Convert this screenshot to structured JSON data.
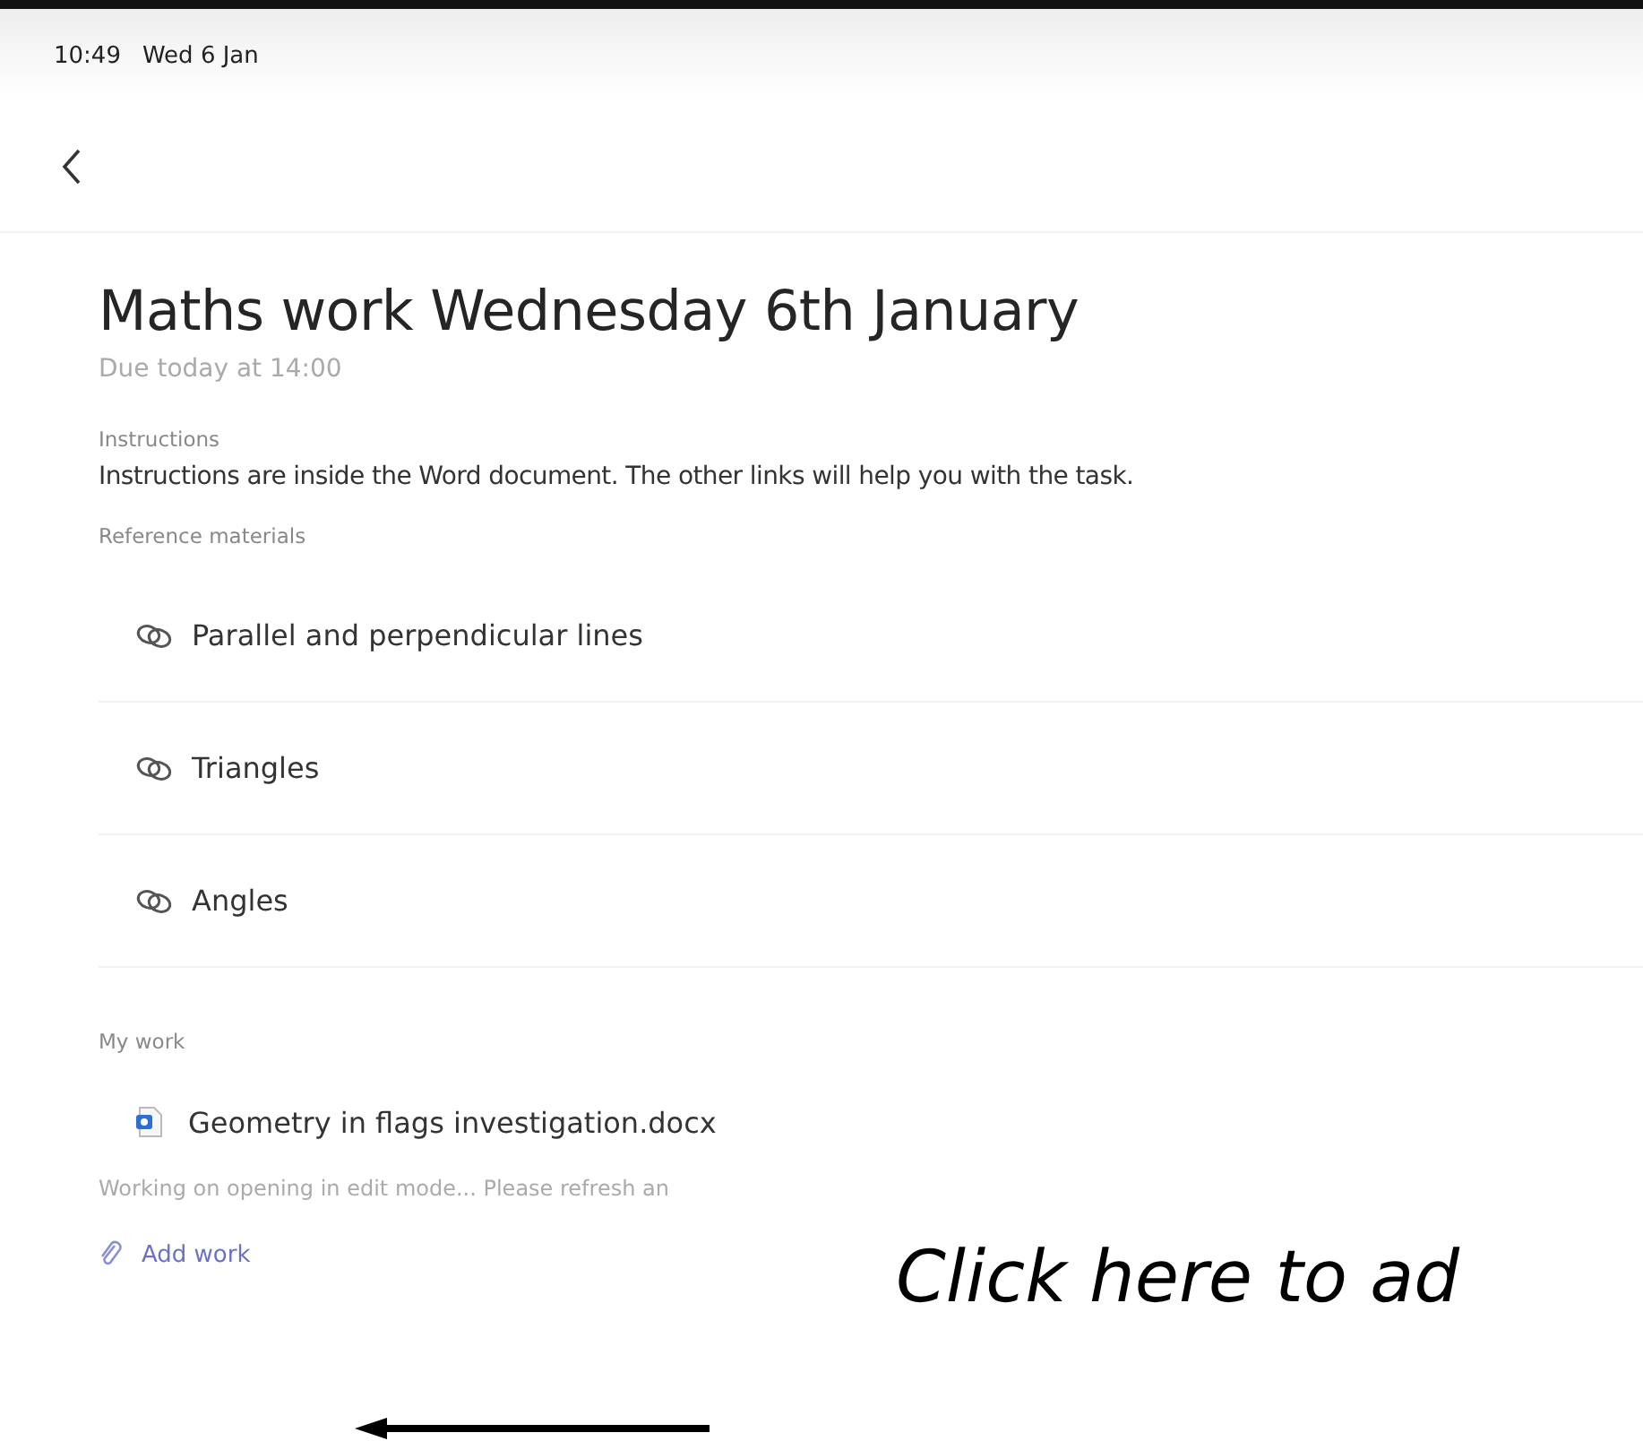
{
  "status_bar": {
    "time": "10:49",
    "date": "Wed 6 Jan"
  },
  "title": "Maths work Wednesday 6th January",
  "due": "Due today at 14:00",
  "instructions": {
    "label": "Instructions",
    "text": "Instructions are inside the Word document. The other links will help you with the task."
  },
  "reference_materials": {
    "label": "Reference materials",
    "items": [
      {
        "title": "Parallel and perpendicular lines"
      },
      {
        "title": "Triangles"
      },
      {
        "title": "Angles"
      }
    ]
  },
  "my_work": {
    "label": "My work",
    "file": "Geometry in flags investigation.docx",
    "note": "Working on opening in edit mode... Please refresh an",
    "add_button": "Add work"
  },
  "callout": "Click here to ad"
}
